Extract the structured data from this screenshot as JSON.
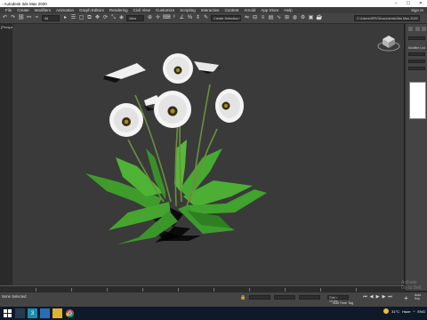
{
  "app": {
    "title": "- Autodesk 3ds Max 2020",
    "window_controls": [
      "–",
      "☐",
      "✕"
    ]
  },
  "menubar": {
    "items": [
      "File",
      "Create",
      "Modifiers",
      "Animation",
      "Graph Editors",
      "Rendering",
      "Civil View",
      "Customize",
      "Scripting",
      "Interactive",
      "Content",
      "Arnold",
      "App Store",
      "Help"
    ],
    "sign_in": "Sign In"
  },
  "toolbar": {
    "selection_filter": "All",
    "reference_coord": "View",
    "named_selection": "Create Selection Se",
    "workspace_path": "C:\\Users\\SRV\\Documents\\3ds Max 2020"
  },
  "viewport": {
    "label": "[Perspective] [Standard] [Default Shading]"
  },
  "command_panel": {
    "modifier_list_label": "Modifier List"
  },
  "status": {
    "message": "None Selected",
    "x_value": "",
    "y_value": "",
    "z_value": "",
    "grid_label": "Grid = 10.0m",
    "time_tag": "Add Time Tag",
    "auto_key": "Auto Key"
  },
  "watermark": {
    "line1": "Activate",
    "line2": "Go to Sett"
  },
  "taskbar": {
    "temperature": "31°C",
    "weather": "Haze",
    "language": "ENG"
  },
  "colors": {
    "viewport_bg": "#3a3a3a",
    "leaf": "#3fa32d",
    "petal": "#f2f2f2",
    "flower_center": "#3a2a12",
    "taskbar": "#0e1a2a"
  }
}
